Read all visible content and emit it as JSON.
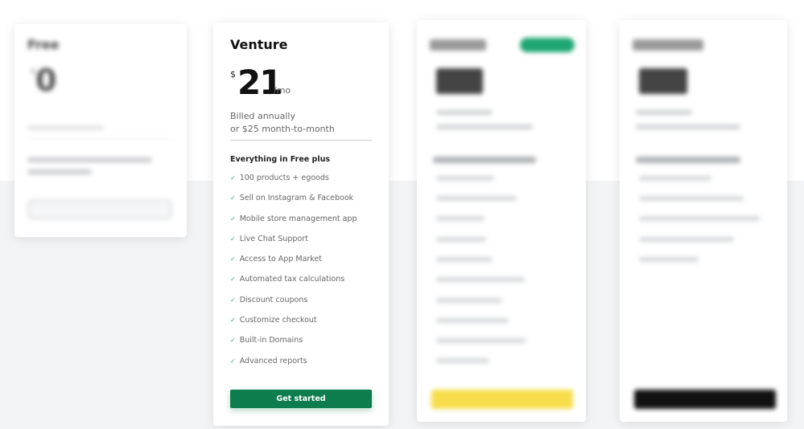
{
  "plans": {
    "free": {
      "name": "Free",
      "currency": "$",
      "price": "0"
    },
    "venture": {
      "name": "Venture",
      "currency": "$",
      "price": "21",
      "period": "/mo",
      "billing_line1": "Billed annually",
      "billing_line2": "or $25 month-to-month",
      "features_heading": "Everything in Free plus",
      "features": [
        "100 products + egoods",
        "Sell on Instagram & Facebook",
        "Mobile store management app",
        "Live Chat Support",
        "Access to App Market",
        "Automated tax calculations",
        "Discount coupons",
        "Customize checkout",
        "Built-in Domains",
        "Advanced reports"
      ],
      "cta": "Get started",
      "check_icon": "check-icon",
      "accent": "#0d7d4d"
    },
    "business": {
      "cta_color": "#f7dd4a",
      "badge_color": "#1ea672"
    },
    "unlimited": {
      "cta_color": "#111111"
    }
  }
}
